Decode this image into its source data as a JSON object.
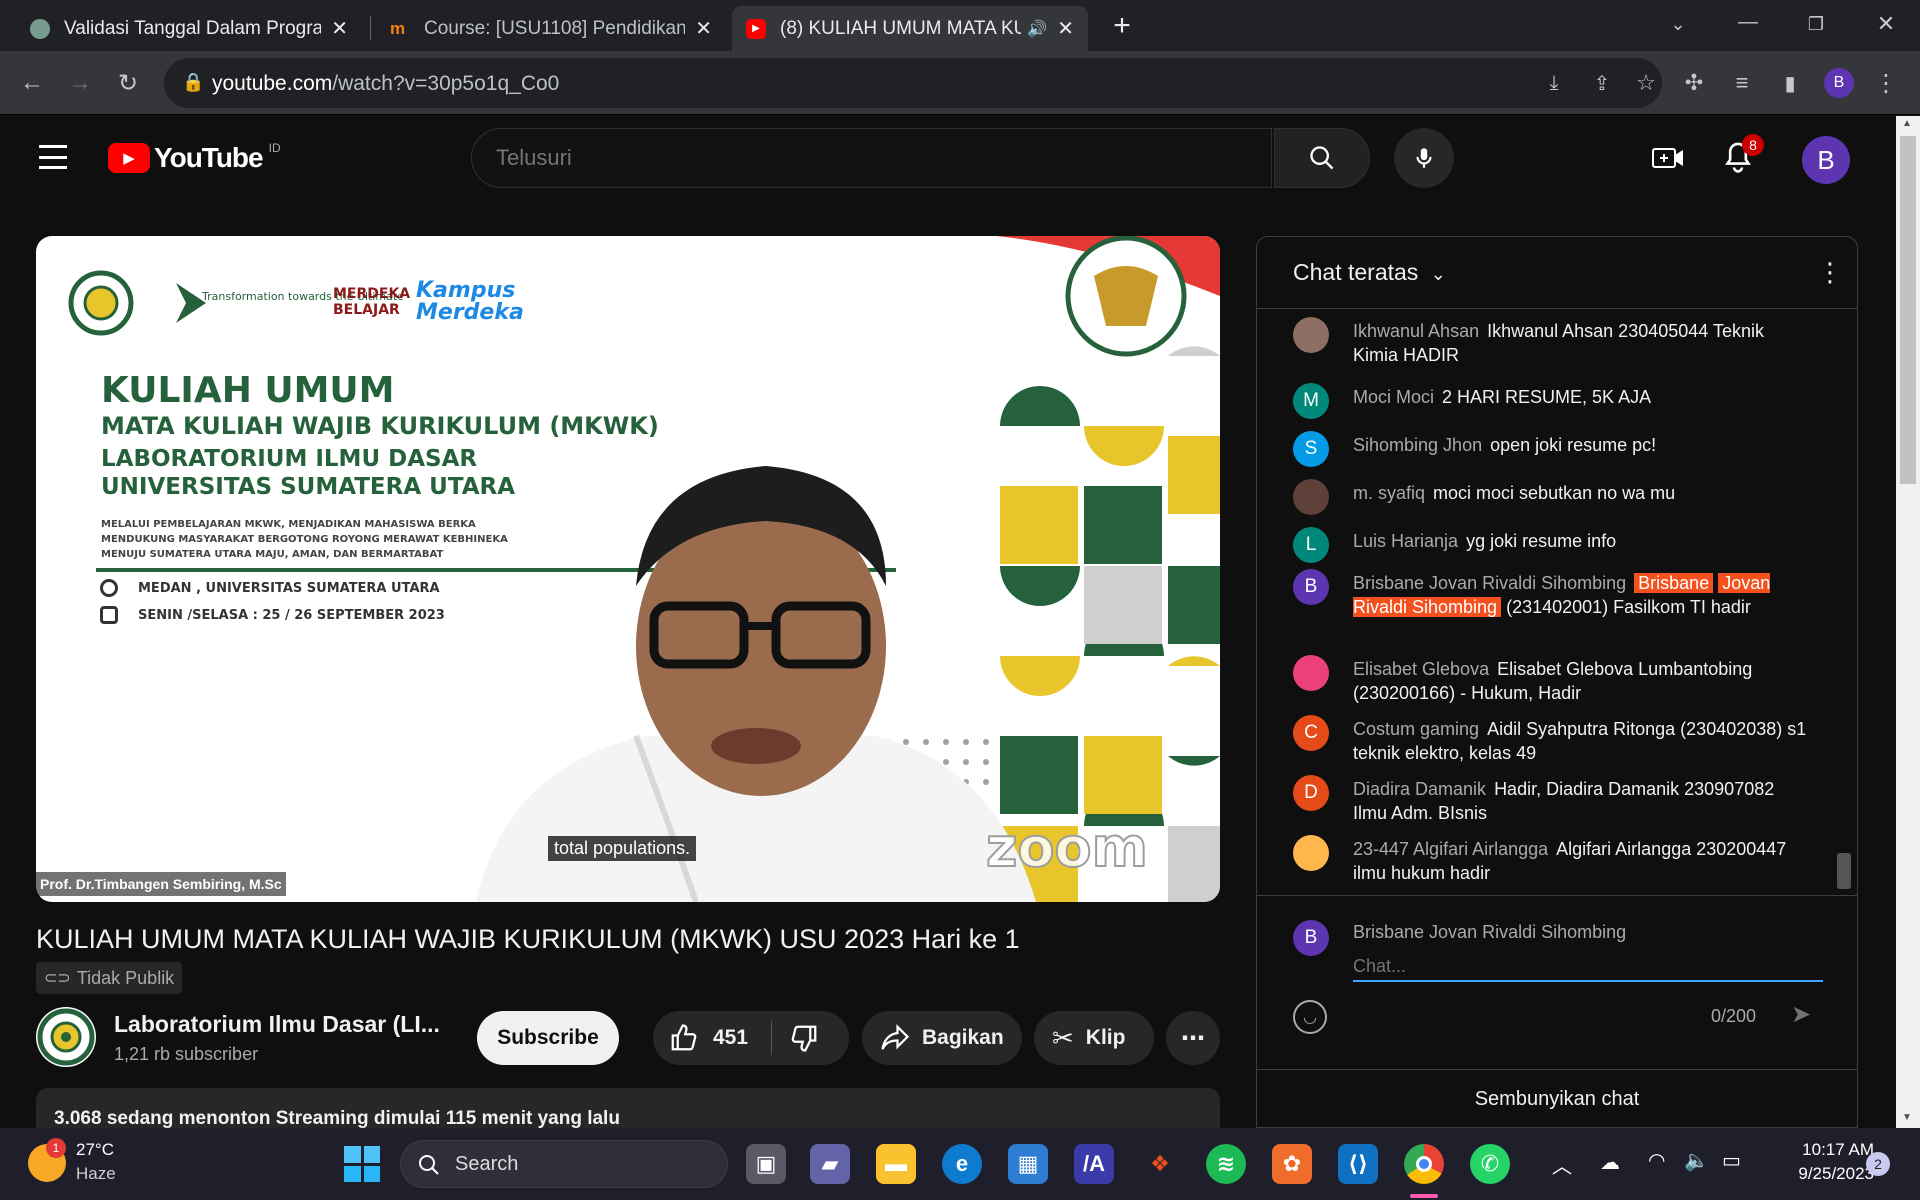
{
  "browser": {
    "tabs": [
      {
        "title": "Validasi Tanggal Dalam Program",
        "active": false
      },
      {
        "title": "Course: [USU1108] Pendidikan Pa",
        "active": false
      },
      {
        "title": "(8) KULIAH UMUM MATA KU",
        "active": true
      }
    ],
    "url_host": "youtube.com",
    "url_path": "/watch?v=30p5o1q_Co0",
    "profile_initial": "B"
  },
  "youtube": {
    "logo_text": "YouTube",
    "region": "ID",
    "search_placeholder": "Telusuri",
    "notification_count": "8",
    "avatar_initial": "B"
  },
  "video": {
    "slide": {
      "heading": "KULIAH UMUM",
      "line2": "MATA KULIAH WAJIB KURIKULUM (MKWK)",
      "line3": "LABORATORIUM ILMU DASAR",
      "line4": "UNIVERSITAS SUMATERA UTARA",
      "small1": "MELALUI PEMBELAJARAN MKWK, MENJADIKAN MAHASISWA BERKA",
      "small2": "MENDUKUNG MASYARAKAT BERGOTONG ROYONG MERAWAT KEBHINEKA",
      "small3": "MENUJU SUMATERA UTARA MAJU, AMAN, DAN BERMARTABAT",
      "location": "MEDAN , UNIVERSITAS SUMATERA UTARA",
      "date": "SENIN /SELASA : 25 / 26 SEPTEMBER 2023",
      "logo_transformation": "Transformation towards the Ultimate",
      "logo_merdeka_belajar": "MERDEKA BELAJAR",
      "logo_kampus_merdeka": "Kampus Merdeka",
      "zoom_watermark": "zoom"
    },
    "caption": "total populations.",
    "speaker": "Prof. Dr.Timbangen Sembiring, M.Sc",
    "title": "KULIAH UMUM MATA KULIAH WAJIB KURIKULUM (MKWK) USU 2023 Hari ke 1",
    "privacy": "Tidak Publik",
    "channel_name": "Laboratorium Ilmu Dasar (LI...",
    "subscribers": "1,21 rb subscriber",
    "subscribe_label": "Subscribe",
    "likes": "451",
    "share_label": "Bagikan",
    "clip_label": "Klip",
    "description_stats": "3.068 sedang menonton  Streaming dimulai 115 menit yang lalu"
  },
  "chat": {
    "title": "Chat teratas",
    "messages": [
      {
        "initial": "",
        "color": "#8d6e63",
        "author": "Ikhwanul Ahsan",
        "text": "Ikhwanul Ahsan 230405044 Teknik Kimia HADIR"
      },
      {
        "initial": "M",
        "color": "#00897b",
        "author": "Moci Moci",
        "text": "2 HARI RESUME, 5K AJA"
      },
      {
        "initial": "S",
        "color": "#039be5",
        "author": "Sihombing Jhon",
        "text": "open joki resume pc!"
      },
      {
        "initial": "",
        "color": "#5d4037",
        "author": "m. syafiq",
        "text": "moci moci sebutkan no wa mu"
      },
      {
        "initial": "L",
        "color": "#00897b",
        "author": "Luis Harianja",
        "text": "yg joki resume info"
      },
      {
        "initial": "B",
        "color": "#5e35b1",
        "author": "Brisbane Jovan Rivaldi Sihombing",
        "mention_a": "Brisbane",
        "mention_b": "Jovan Rivaldi Sihombing",
        "text": "(231402001) Fasilkom TI hadir"
      },
      {
        "initial": "",
        "color": "#ec407a",
        "author": "Elisabet Glebova",
        "text": "Elisabet Glebova Lumbantobing (230200166) - Hukum, Hadir"
      },
      {
        "initial": "C",
        "color": "#e64a19",
        "author": "Costum gaming",
        "text": "Aidil Syahputra Ritonga (230402038) s1 teknik elektro, kelas 49"
      },
      {
        "initial": "D",
        "color": "#e64a19",
        "author": "Diadira Damanik",
        "text": "Hadir, Diadira Damanik 230907082 Ilmu Adm. BIsnis"
      },
      {
        "initial": "",
        "color": "#ffb74d",
        "author": "23-447 Algifari Airlangga",
        "text": "Algifari Airlangga 230200447 ilmu hukum hadir"
      }
    ],
    "input_user": "Brisbane Jovan Rivaldi Sihombing",
    "input_placeholder": "Chat...",
    "char_count": "0/200",
    "hide_label": "Sembunyikan chat"
  },
  "taskbar": {
    "weather_temp": "27°C",
    "weather_desc": "Haze",
    "weather_badge": "1",
    "search_placeholder": "Search",
    "time": "10:17 AM",
    "date": "9/25/2023",
    "notification_count": "2"
  }
}
